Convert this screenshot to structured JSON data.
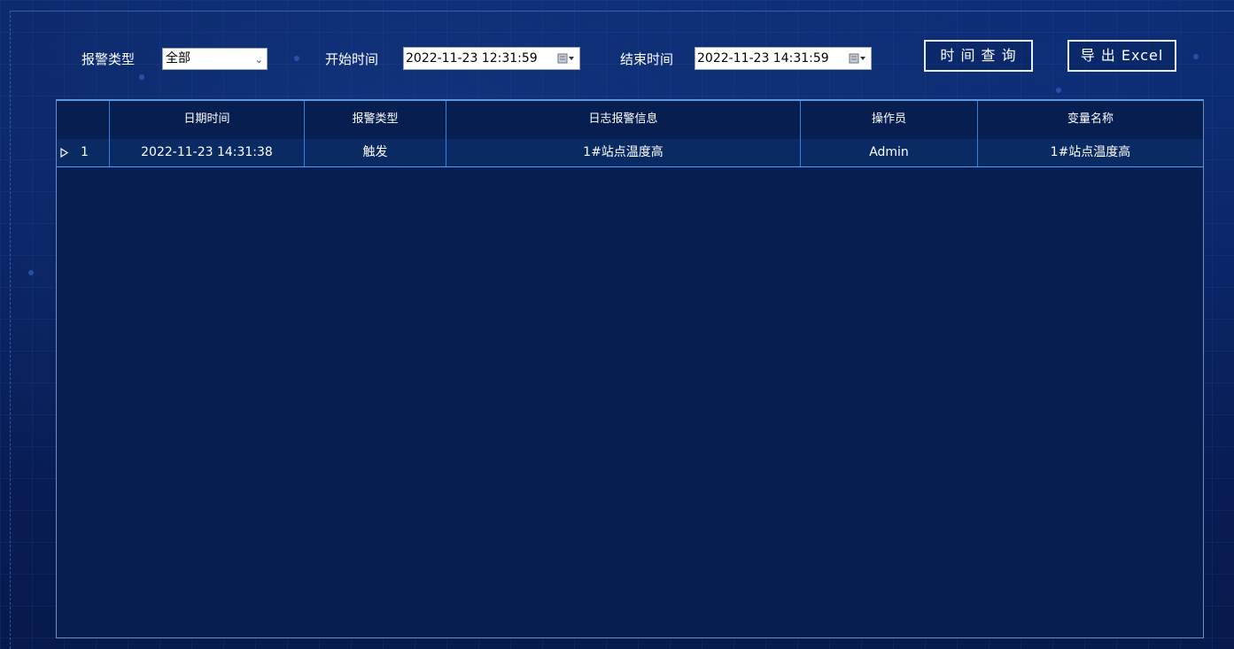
{
  "filters": {
    "alarm_type_label": "报警类型",
    "alarm_type_value": "全部",
    "start_label": "开始时间",
    "start_value": "2022-11-23 12:31:59",
    "end_label": "结束时间",
    "end_value": "2022-11-23 14:31:59"
  },
  "buttons": {
    "query": "时 间 查 询",
    "export": "导 出 Excel"
  },
  "table": {
    "columns": [
      "",
      "日期时间",
      "报警类型",
      "日志报警信息",
      "操作员",
      "变量名称"
    ],
    "rows": [
      {
        "index": "1",
        "datetime": "2022-11-23 14:31:38",
        "alarm_type": "触发",
        "message": "1#站点温度高",
        "operator": "Admin",
        "variable": "1#站点温度高"
      }
    ]
  },
  "icons": {
    "select_chevron": "chevron-down-icon",
    "calendar": "calendar-dropdown-icon",
    "row_indicator": "triangle-right-icon"
  },
  "colors": {
    "background": "#0a2463",
    "table_background": "#071f50",
    "grid_line": "#3f7fd8",
    "text": "#ffffff"
  }
}
